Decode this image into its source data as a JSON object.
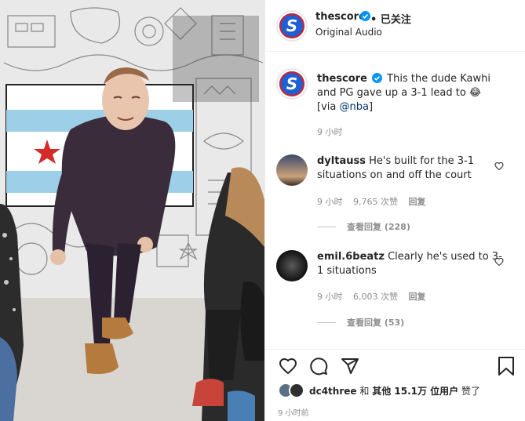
{
  "header": {
    "username": "thescore",
    "follow_status": "• 已关注",
    "audio": "Original Audio"
  },
  "caption": {
    "username": "thescore",
    "text": "This the dude Kawhi and PG gave up a 3-1 lead to 😂",
    "via_prefix": "[via ",
    "via_mention": "@nba",
    "via_suffix": "]",
    "time": "9 小时"
  },
  "comments": [
    {
      "username": "dyltauss",
      "text": "He's built for the 3-1 situations on and off the court",
      "time": "9 小时",
      "likes": "9,765 次赞",
      "reply": "回复",
      "view_replies": "查看回复 (228)"
    },
    {
      "username": "emil.6beatz",
      "text": "Clearly he's used to 3-1 situations",
      "time": "9 小时",
      "likes": "6,003 次赞",
      "reply": "回复",
      "view_replies": "查看回复 (53)"
    }
  ],
  "likes": {
    "user": "dc4three",
    "connector": "和",
    "others": "其他 15.1万 位用户",
    "suffix": "赞了"
  },
  "post_time": "9 小时前",
  "icons": [
    "verified-icon",
    "heart-icon",
    "comment-icon",
    "share-icon",
    "bookmark-icon"
  ],
  "colors": {
    "verified": "#0095f6",
    "mention": "#00376b",
    "meta": "#8e8e8e",
    "score_blue": "#1f5fd1",
    "score_red": "#d81f26"
  }
}
